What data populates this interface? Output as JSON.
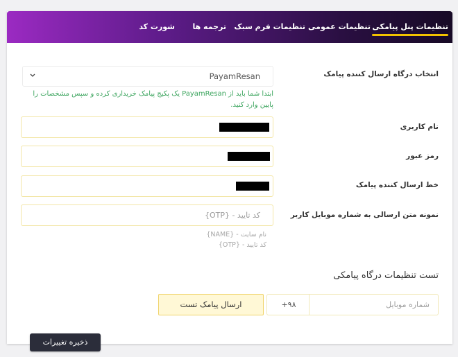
{
  "tabs": [
    {
      "label": "تنظیمات پنل پیامکی",
      "active": true
    },
    {
      "label": "تنظیمات عمومی",
      "active": false
    },
    {
      "label": "تنظیمات فرم",
      "active": false
    },
    {
      "label": "سبک",
      "active": false
    },
    {
      "label": "ترجمه ها",
      "active": false
    },
    {
      "label": "شورت کد",
      "active": false
    }
  ],
  "gateway": {
    "label": "انتخاب درگاه ارسال کننده پیامک",
    "selected": "PayamResan",
    "help": "ابتدا شما باید از PayamResan یک پکیج پیامک خریداری کرده و سپس مشخصات را پایین وارد کنید."
  },
  "username": {
    "label": "نام کاربری"
  },
  "password": {
    "label": "رمز عبور"
  },
  "sender_line": {
    "label": "خط ارسال کننده پیامک"
  },
  "message_template": {
    "label": "نمونه متن ارسالی به شماره موبایل کاربر",
    "placeholder": "کد تایید - {OTP}",
    "hints": [
      "نام سایت - {NAME}",
      "کد تایید - {OTP}"
    ]
  },
  "test_section": {
    "title": "تست تنظیمات درگاه پیامکی",
    "mobile_placeholder": "شماره موبایل",
    "country_code": "+۹۸",
    "send_button": "ارسال پیامک تست"
  },
  "save_button": "ذخیره تغییرات",
  "colors": {
    "accent": "#f2c200",
    "nav_start": "#9b2ac2",
    "nav_end": "#170a26",
    "help_text": "#3da55f"
  }
}
